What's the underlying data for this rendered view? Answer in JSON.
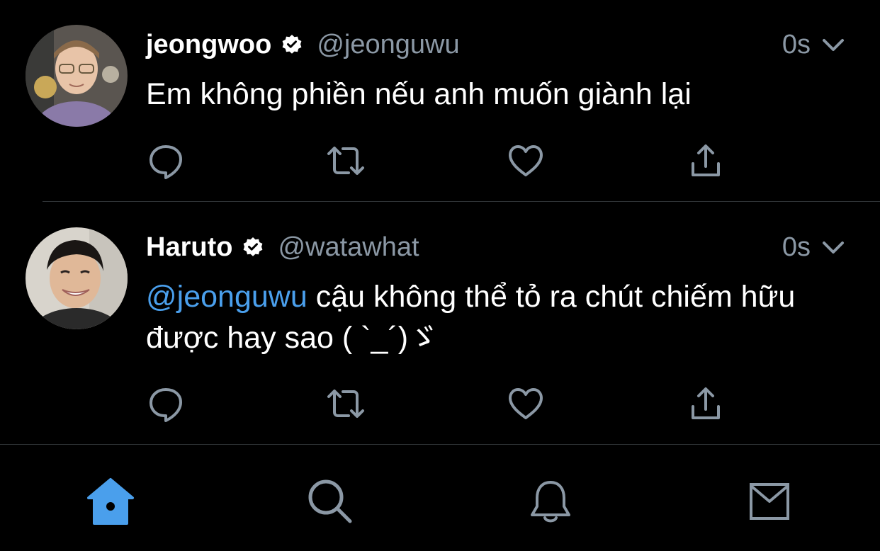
{
  "colors": {
    "background": "#000000",
    "text": "#ffffff",
    "secondary_text": "#8b98a5",
    "mention": "#4a9fec",
    "active_tab": "#4a9fec",
    "divider": "#2f3336"
  },
  "tweets": [
    {
      "name": "jeongwoo",
      "verified": true,
      "handle": "@jeonguwu",
      "time": "0s",
      "text": "Em không phiền nếu anh muốn giành lại",
      "avatar_icon": "user-avatar"
    },
    {
      "name": "Haruto",
      "verified": true,
      "handle": "@watawhat",
      "time": "0s",
      "mention": "@jeonguwu",
      "text_after_mention": " cậu không thể tỏ ra chút chiếm hữu được hay sao ( `_´)ゞ",
      "avatar_icon": "user-avatar"
    }
  ],
  "tweet_actions": [
    "reply-icon",
    "retweet-icon",
    "like-icon",
    "share-icon"
  ],
  "tabbar": {
    "active": "home",
    "tabs": [
      "home-icon",
      "search-icon",
      "notifications-icon",
      "messages-icon"
    ]
  }
}
